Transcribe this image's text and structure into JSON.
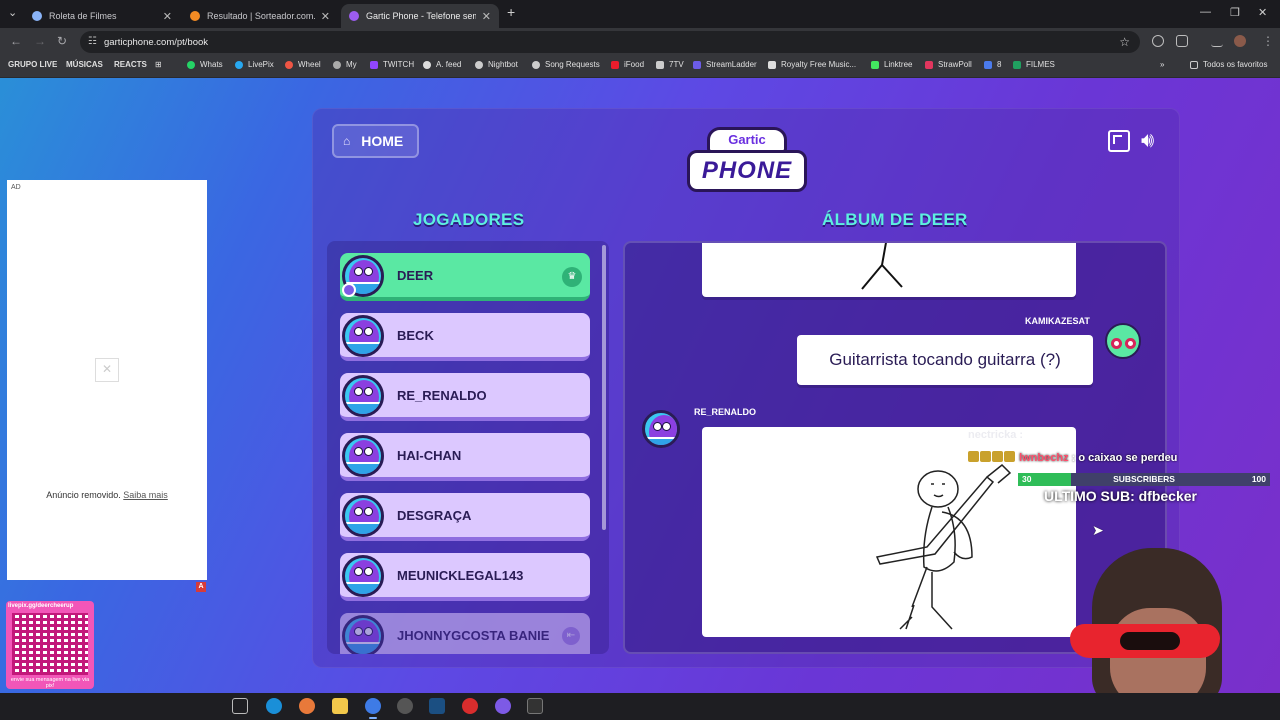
{
  "browser": {
    "tabs": [
      {
        "title": "Roleta de Filmes",
        "active": false,
        "color": "#8ab4f8"
      },
      {
        "title": "Resultado | Sorteador.com.br -",
        "active": false,
        "color": "#f28b24"
      },
      {
        "title": "Gartic Phone - Telefone sem fio",
        "active": true,
        "color": "#9c5cf0"
      }
    ],
    "new_tab_label": "+",
    "url": "garticphone.com/pt/book",
    "bookmarks": [
      {
        "label": "GRUPO LIVE",
        "bold": true
      },
      {
        "label": "MÚSICAS",
        "bold": true
      },
      {
        "label": "REACTS",
        "bold": true
      },
      {
        "label": "Whats",
        "color": "#25d366"
      },
      {
        "label": "LivePix",
        "color": "#28a8f0"
      },
      {
        "label": "Wheel",
        "color": "#e54"
      },
      {
        "label": "My",
        "color": "#aaa"
      },
      {
        "label": "TWITCH",
        "color": "#9146ff"
      },
      {
        "label": "A. feed",
        "color": "#ddd"
      },
      {
        "label": "Nightbot",
        "color": "#ccc"
      },
      {
        "label": "Song Requests",
        "color": "#ccc"
      },
      {
        "label": "iFood",
        "color": "#ea1d2c"
      },
      {
        "label": "7TV",
        "color": "#ccc"
      },
      {
        "label": "StreamLadder",
        "color": "#6c5ce7"
      },
      {
        "label": "Royalty Free Music...",
        "color": "#ddd"
      },
      {
        "label": "Linktree",
        "color": "#43e660"
      },
      {
        "label": "StrawPoll",
        "color": "#e2365e"
      },
      {
        "label": "8",
        "color": "#4b7bec"
      },
      {
        "label": "FILMES",
        "color": "#20a060"
      }
    ],
    "all_bookmarks_label": "Todos os favoritos"
  },
  "ad": {
    "tag": "AD",
    "removed_text": "Anúncio removido.",
    "learn_more": "Saiba mais",
    "badge": "A"
  },
  "qr": {
    "url": "livepix.gg/deercheerup",
    "caption": "envie sua mensagem na live via pix!"
  },
  "game": {
    "home_label": "HOME",
    "logo_top": "Gartic",
    "logo_bottom": "PHONE",
    "players_title": "JOGADORES",
    "album_title": "ÁLBUM DE DEER",
    "players": [
      {
        "name": "DEER",
        "owner": true
      },
      {
        "name": "BECK"
      },
      {
        "name": "RE_RENALDO"
      },
      {
        "name": "HAI-CHAN"
      },
      {
        "name": "DESGRAÇA"
      },
      {
        "name": "MEUNICKLEGAL143"
      },
      {
        "name": "JHONNYGCOSTA BANIE"
      }
    ],
    "album": {
      "guess_author": "KAMIKAZESAT",
      "guess_text": "Guitarrista tocando guitarra (?)",
      "draw_author": "RE_RENALDO"
    }
  },
  "overlay": {
    "ghost_chat": "nectricka :",
    "chat_user": "lwnbechz",
    "chat_message": ": o caixao se perdeu",
    "sub_current": "30",
    "sub_label": "SUBSCRIBERS",
    "sub_goal": "100",
    "sub_progress": 0.3,
    "last_sub": "ULTIMO SUB: dfbecker"
  },
  "colors": {
    "accent_title": "#5df0df",
    "owner_row": "#5ae8a3",
    "player_row": "#dcc8ff"
  }
}
